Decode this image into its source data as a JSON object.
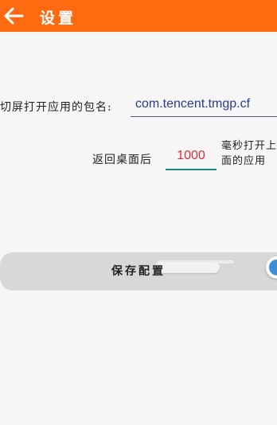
{
  "app_bar": {
    "title": "设置",
    "back_icon": "back-arrow-icon",
    "background_color": "#ff6a10"
  },
  "settings": {
    "package_label": "切屏打开应用的包名:",
    "package_value": "com.tencent.tmgp.cf",
    "return_label": "返回桌面后",
    "delay_ms": "1000",
    "delay_note": "毫秒打开上面的应用"
  },
  "save": {
    "label": "保存配置"
  }
}
